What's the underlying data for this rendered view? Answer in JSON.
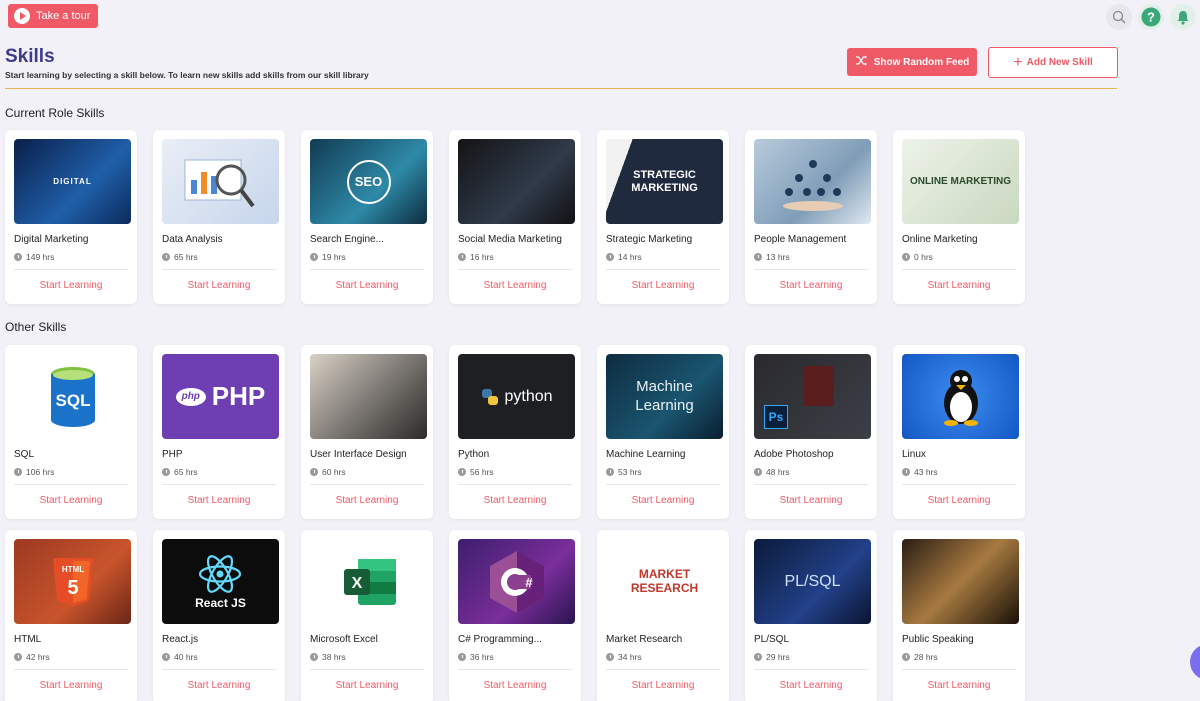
{
  "header": {
    "tour_label": "Take a tour",
    "title": "Skills",
    "subtitle": "Start learning by selecting a skill below. To learn new skills add skills from our skill library",
    "random_feed_label": "Show Random Feed",
    "add_skill_label": "Add New Skill"
  },
  "colors": {
    "accent": "#ef5a66",
    "title": "#3e3b8c",
    "divider": "#e8b44e",
    "background": "#f1f1f7"
  },
  "icons": [
    "search-icon",
    "help-icon",
    "bell-icon"
  ],
  "current_role": {
    "title": "Current Role Skills",
    "skills": [
      {
        "name": "Digital Marketing",
        "hours": "149 hrs",
        "cta": "Start Learning",
        "thumb_text": "DIGITAL",
        "thumb_icon": "digital-marketing-image"
      },
      {
        "name": "Data Analysis",
        "hours": "65 hrs",
        "cta": "Start Learning",
        "thumb_text": "",
        "thumb_icon": "magnifier-chart-image"
      },
      {
        "name": "Search Engine...",
        "hours": "19 hrs",
        "cta": "Start Learning",
        "thumb_text": "SEO",
        "thumb_icon": "seo-image"
      },
      {
        "name": "Social Media Marketing",
        "hours": "16 hrs",
        "cta": "Start Learning",
        "thumb_text": "",
        "thumb_icon": "phone-social-image"
      },
      {
        "name": "Strategic Marketing",
        "hours": "14 hrs",
        "cta": "Start Learning",
        "thumb_text": "STRATEGIC MARKETING",
        "thumb_icon": "strategic-marketing-image"
      },
      {
        "name": "People Management",
        "hours": "13 hrs",
        "cta": "Start Learning",
        "thumb_text": "",
        "thumb_icon": "people-network-image"
      },
      {
        "name": "Online Marketing",
        "hours": "0 hrs",
        "cta": "Start Learning",
        "thumb_text": "ONLINE MARKETING",
        "thumb_icon": "online-marketing-image"
      }
    ]
  },
  "other": {
    "title": "Other Skills",
    "skills": [
      {
        "name": "SQL",
        "hours": "106 hrs",
        "cta": "Start Learning",
        "thumb_text": "SQL",
        "thumb_icon": "sql-database-icon"
      },
      {
        "name": "PHP",
        "hours": "65 hrs",
        "cta": "Start Learning",
        "thumb_text": "PHP",
        "thumb_icon": "php-logo"
      },
      {
        "name": "User Interface Design",
        "hours": "60 hrs",
        "cta": "Start Learning",
        "thumb_text": "",
        "thumb_icon": "ui-design-image"
      },
      {
        "name": "Python",
        "hours": "56 hrs",
        "cta": "Start Learning",
        "thumb_text": "python",
        "thumb_icon": "python-logo"
      },
      {
        "name": "Machine Learning",
        "hours": "53 hrs",
        "cta": "Start Learning",
        "thumb_text": "Machine Learning",
        "thumb_icon": "machine-learning-image"
      },
      {
        "name": "Adobe Photoshop",
        "hours": "48 hrs",
        "cta": "Start Learning",
        "thumb_text": "Ps",
        "thumb_icon": "photoshop-logo"
      },
      {
        "name": "Linux",
        "hours": "43 hrs",
        "cta": "Start Learning",
        "thumb_text": "",
        "thumb_icon": "linux-penguin-logo"
      },
      {
        "name": "HTML",
        "hours": "42 hrs",
        "cta": "Start Learning",
        "thumb_text": "HTML",
        "thumb_icon": "html5-logo"
      },
      {
        "name": "React.js",
        "hours": "40 hrs",
        "cta": "Start Learning",
        "thumb_text": "React JS",
        "thumb_icon": "react-logo"
      },
      {
        "name": "Microsoft Excel",
        "hours": "38 hrs",
        "cta": "Start Learning",
        "thumb_text": "X",
        "thumb_icon": "excel-logo"
      },
      {
        "name": "C# Programming...",
        "hours": "36 hrs",
        "cta": "Start Learning",
        "thumb_text": "C#",
        "thumb_icon": "csharp-logo"
      },
      {
        "name": "Market Research",
        "hours": "34 hrs",
        "cta": "Start Learning",
        "thumb_text": "MARKET RESEARCH",
        "thumb_icon": "market-research-image"
      },
      {
        "name": "PL/SQL",
        "hours": "29 hrs",
        "cta": "Start Learning",
        "thumb_text": "PL/SQL",
        "thumb_icon": "plsql-image"
      },
      {
        "name": "Public Speaking",
        "hours": "28 hrs",
        "cta": "Start Learning",
        "thumb_text": "",
        "thumb_icon": "public-speaking-image"
      }
    ]
  }
}
